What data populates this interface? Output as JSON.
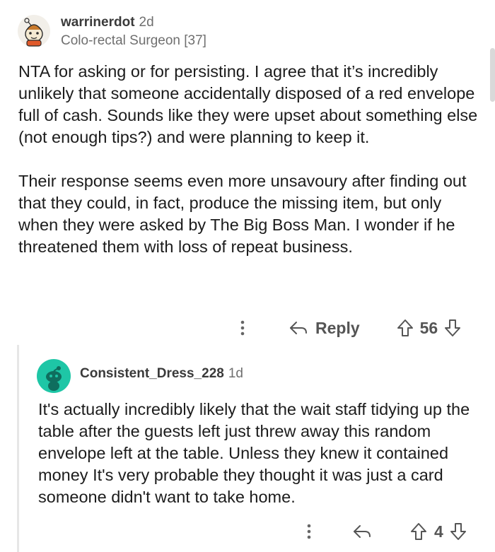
{
  "comments": [
    {
      "username": "warrinerdot",
      "age": "2d",
      "flair": "Colo-rectal Surgeon [37]",
      "avatar_icon": "snoo-avatar-costume-icon",
      "paragraphs": [
        "NTA for asking or for persisting. I agree that it’s incredibly unlikely that someone accidentally disposed of a red envelope full of cash. Sounds like they were upset about something else (not enough tips?) and were planning to keep it.",
        "Their response seems even more unsavoury after finding out that they could, in fact, produce the missing item, but only when they were asked by The Big Boss Man. I wonder if he threatened them with loss of repeat business."
      ],
      "actions": {
        "more_icon": "more-vertical-icon",
        "reply_label": "Reply",
        "reply_icon": "reply-arrow-icon",
        "upvote_icon": "upvote-arrow-icon",
        "score": "56",
        "downvote_icon": "downvote-arrow-icon"
      }
    },
    {
      "username": "Consistent_Dress_228",
      "age": "1d",
      "avatar_icon": "snoo-avatar-teal-icon",
      "avatar_color": "#1ec6a6",
      "paragraphs": [
        "It's actually incredibly likely that the wait staff tidying up the table after the guests left just threw away this random envelope left at the table. Unless they knew it contained money It's very probable they thought it was just a card someone didn't want to take home."
      ],
      "actions": {
        "more_icon": "more-vertical-icon",
        "reply_icon": "reply-arrow-icon",
        "upvote_icon": "upvote-arrow-icon",
        "score": "4",
        "downvote_icon": "downvote-arrow-icon"
      }
    }
  ]
}
